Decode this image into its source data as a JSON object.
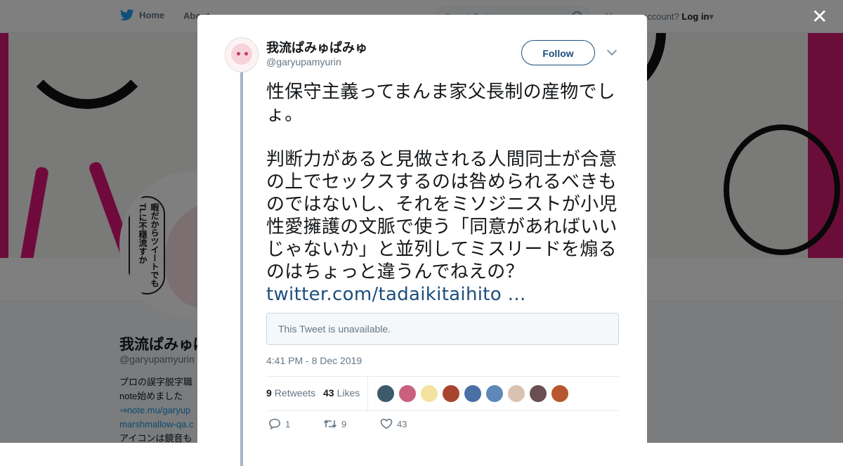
{
  "nav": {
    "home": "Home",
    "about": "About",
    "search_placeholder": "Search Twitter",
    "have_account": "Have an account?",
    "login": "Log in"
  },
  "profile": {
    "name": "我流ぱみゅぱみゅ",
    "handle": "@garyupamyurin",
    "avatar_bubble": "暇だからツイートでもTLに不穏流すか",
    "bio_lines": [
      "プロの誤字脱字職",
      "note始めました",
      "⇒note.mu/garyup",
      "marshmallow-qa.c",
      "アイコンは鏡音も"
    ]
  },
  "tweet": {
    "author_name": "我流ぱみゅぱみゅ",
    "author_handle": "@garyupamyurin",
    "follow_label": "Follow",
    "text": "性保守主義ってまんま家父長制の産物でしょ。\n\n判断力があると見做される人間同士が合意の上でセックスするのは咎められるべきものではないし、それをミソジニストが小児性愛擁護の文脈で使う「同意があればいいじゃないか」と並列してミスリードを煽るのはちょっと違うんでねえの？ ",
    "link": "twitter.com/tadaikitaihito …",
    "quote_unavailable": "This Tweet is unavailable.",
    "timestamp": "4:41 PM - 8 Dec 2019",
    "retweets_count": "9",
    "retweets_label": "Retweets",
    "likes_count": "43",
    "likes_label": "Likes",
    "reply_count": "1",
    "retweet_action_count": "9",
    "like_action_count": "43"
  },
  "liker_colors": [
    "#3d5a6c",
    "#c9607e",
    "#f3e2a0",
    "#a8442e",
    "#4a6fa5",
    "#5d88b8",
    "#d9c3b0",
    "#6b4e52",
    "#b8562d"
  ],
  "colors": {
    "link": "#1d4e7e",
    "overlay": "rgba(0,0,0,0.5)",
    "accent_pink": "#d61a73"
  }
}
